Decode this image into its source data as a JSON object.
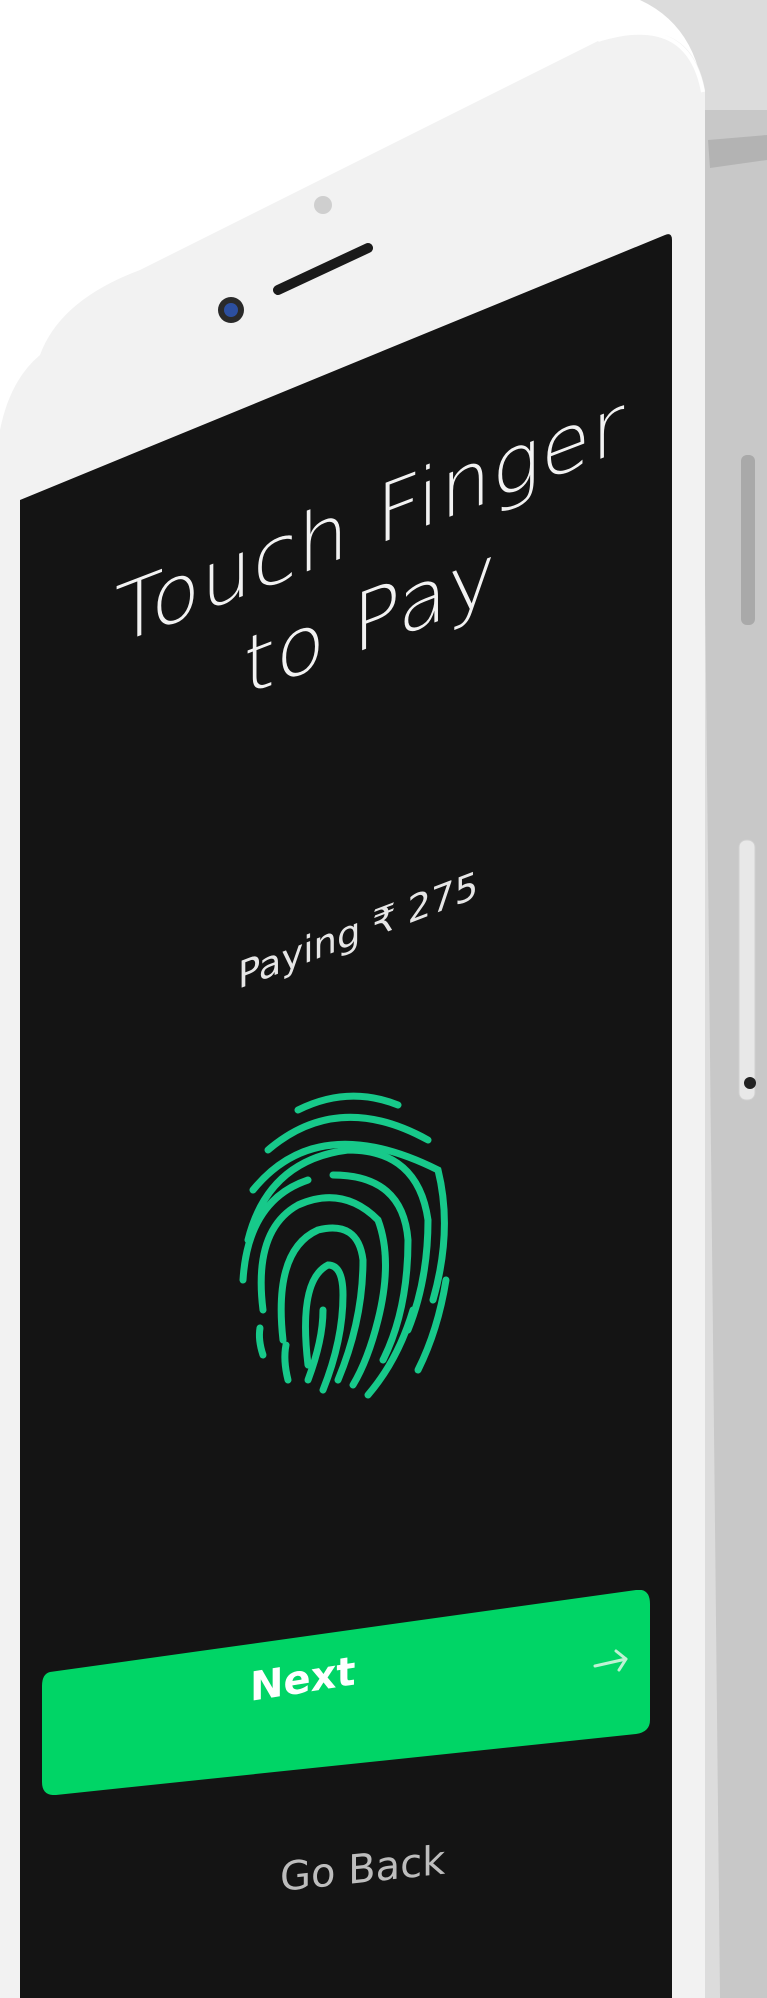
{
  "screen": {
    "title": "Touch Finger\nto Pay",
    "subtitle": "Paying ₹ 275",
    "next_label": "Next",
    "go_back_label": "Go Back"
  },
  "icons": {
    "fingerprint": "fingerprint-icon",
    "next_arrow": "arrow-right-icon"
  },
  "colors": {
    "screen_background": "#141414",
    "accent_green": "#00d566",
    "fingerprint_green": "#17c98a",
    "phone_frame": "#f2f2f2"
  }
}
